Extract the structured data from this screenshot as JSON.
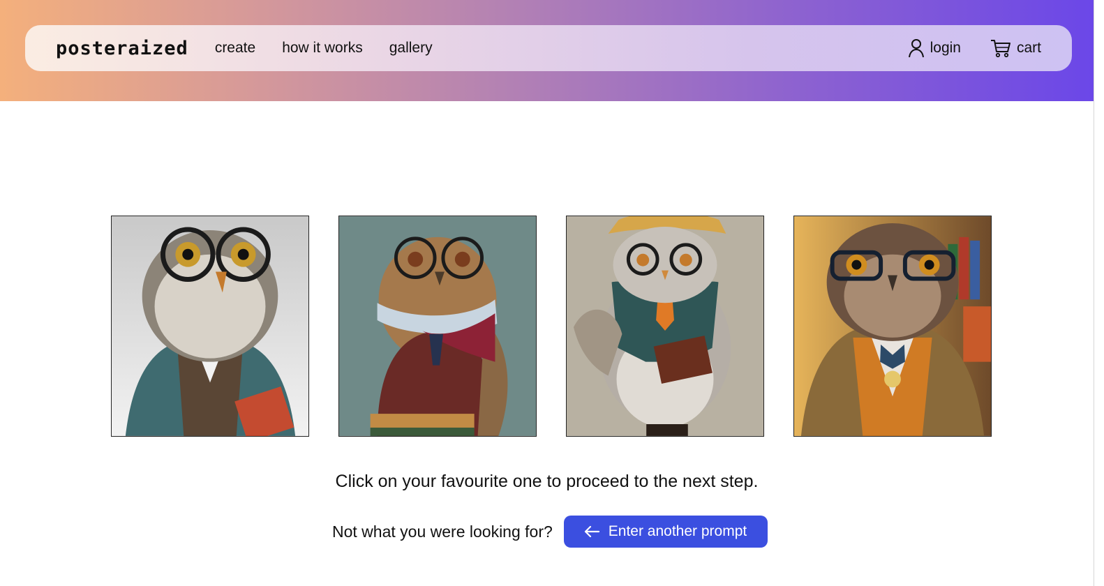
{
  "header": {
    "logo": "posteraized",
    "nav": [
      {
        "label": "create"
      },
      {
        "label": "how it works"
      },
      {
        "label": "gallery"
      }
    ],
    "login": {
      "label": "login",
      "icon": "user-icon"
    },
    "cart": {
      "label": "cart",
      "icon": "cart-icon"
    }
  },
  "gallery": {
    "images": [
      {
        "subject": "owl with round glasses and bow tie",
        "bg": "#d9d9d9"
      },
      {
        "subject": "owl with glasses and scarf",
        "bg": "#6f8a88"
      },
      {
        "subject": "owl with hat, glasses and book",
        "bg": "#b8b1a2"
      },
      {
        "subject": "owl with glasses in library",
        "bg": "#c9963f"
      }
    ]
  },
  "instruction": "Click on your favourite one to proceed to the next step.",
  "prompt": {
    "question": "Not what you were looking for?",
    "button_label": "Enter another prompt",
    "button_icon": "arrow-left-icon"
  },
  "colors": {
    "accent": "#3b4fe0",
    "gradient_start": "#f4b07c",
    "gradient_end": "#6b47e8"
  }
}
